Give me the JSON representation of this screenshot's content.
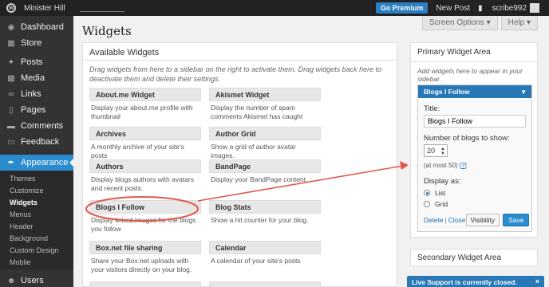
{
  "adminbar": {
    "site_name": "Minister Hill",
    "go_premium": "Go Premium",
    "new_post": "New Post",
    "notifications_icon": "bell-icon",
    "username": "scribe992"
  },
  "sidebar": {
    "items": [
      {
        "label": "Dashboard",
        "icon": "dashboard-icon"
      },
      {
        "label": "Store",
        "icon": "store-icon"
      },
      {
        "label": "Posts",
        "icon": "pin-icon"
      },
      {
        "label": "Media",
        "icon": "media-icon"
      },
      {
        "label": "Links",
        "icon": "link-icon"
      },
      {
        "label": "Pages",
        "icon": "page-icon"
      },
      {
        "label": "Comments",
        "icon": "comment-icon"
      },
      {
        "label": "Feedback",
        "icon": "feedback-icon"
      },
      {
        "label": "Appearance",
        "icon": "brush-icon"
      },
      {
        "label": "Users",
        "icon": "user-icon"
      }
    ],
    "submenu": [
      "Themes",
      "Customize",
      "Widgets",
      "Menus",
      "Header",
      "Background",
      "Custom Design",
      "Mobile"
    ]
  },
  "screen_options": {
    "screen": "Screen Options",
    "help": "Help"
  },
  "page_title": "Widgets",
  "available": {
    "title": "Available Widgets",
    "description": "Drag widgets from here to a sidebar on the right to activate them. Drag widgets back here to deactivate them and delete their settings.",
    "widgets": [
      {
        "name": "About.me Widget",
        "desc": "Display your about.me profile with thumbnail"
      },
      {
        "name": "Akismet Widget",
        "desc": "Display the number of spam comments Akismet has caught"
      },
      {
        "name": "Archives",
        "desc": "A monthly archive of your site's posts"
      },
      {
        "name": "Author Grid",
        "desc": "Show a grid of author avatar images."
      },
      {
        "name": "Authors",
        "desc": "Display blogs authors with avatars and recent posts."
      },
      {
        "name": "BandPage",
        "desc": "Display your BandPage content"
      },
      {
        "name": "Blogs I Follow",
        "desc": "Display linked images for the blogs you follow"
      },
      {
        "name": "Blog Stats",
        "desc": "Show a hit counter for your blog."
      },
      {
        "name": "Box.net file sharing",
        "desc": "Share your Box.net uploads with your visitors directly on your blog."
      },
      {
        "name": "Calendar",
        "desc": "A calendar of your site's posts"
      }
    ]
  },
  "primary": {
    "title": "Primary Widget Area",
    "description": "Add widgets here to appear in your sidebar.",
    "widget": {
      "header": "Blogs I Follow",
      "title_label": "Title:",
      "title_value": "Blogs I Follow",
      "count_label": "Number of blogs to show:",
      "count_value": "20",
      "at_most": "(at most 50)",
      "help_link": "?",
      "display_label": "Display as:",
      "options": [
        "List",
        "Grid"
      ],
      "selected": "List",
      "delete": "Delete",
      "separator": "|",
      "close": "Close",
      "visibility": "Visibility",
      "save": "Save"
    }
  },
  "secondary": {
    "title": "Secondary Widget Area"
  },
  "live_support": {
    "text": "Live Support is currently closed.",
    "close": "×"
  },
  "annotation": {
    "color": "#e05a4b"
  }
}
